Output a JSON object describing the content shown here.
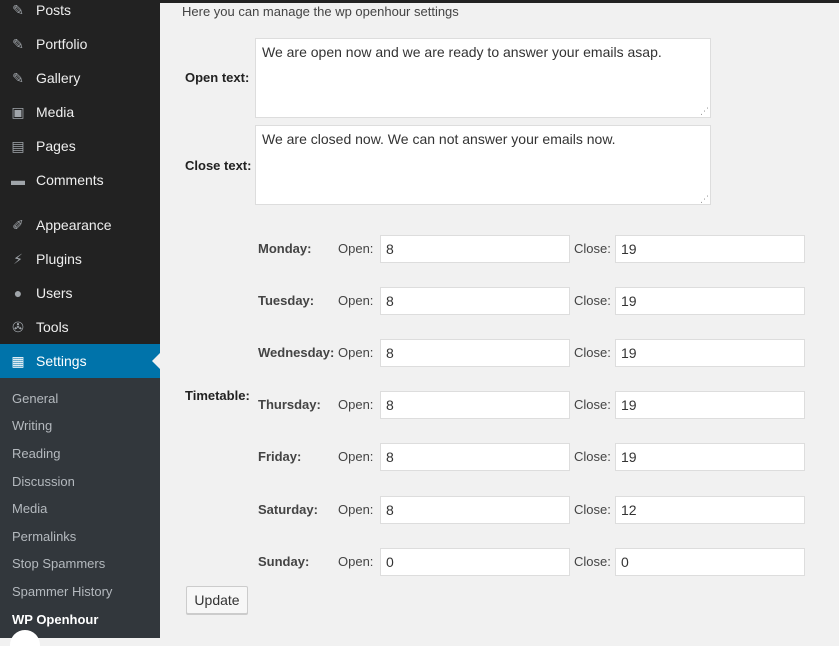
{
  "sidebar": {
    "items": [
      {
        "label": "Posts",
        "icon": "pushpin-icon",
        "glyph": "✎"
      },
      {
        "label": "Portfolio",
        "icon": "pushpin-icon",
        "glyph": "✎"
      },
      {
        "label": "Gallery",
        "icon": "pushpin-icon",
        "glyph": "✎"
      },
      {
        "label": "Media",
        "icon": "media-icon",
        "glyph": "▣"
      },
      {
        "label": "Pages",
        "icon": "pages-icon",
        "glyph": "▤"
      },
      {
        "label": "Comments",
        "icon": "comments-icon",
        "glyph": "▬"
      },
      {
        "label": "Appearance",
        "icon": "appearance-icon",
        "glyph": "✐"
      },
      {
        "label": "Plugins",
        "icon": "plugins-icon",
        "glyph": "⚡"
      },
      {
        "label": "Users",
        "icon": "users-icon",
        "glyph": "●"
      },
      {
        "label": "Tools",
        "icon": "tools-icon",
        "glyph": "✇"
      },
      {
        "label": "Settings",
        "icon": "settings-icon",
        "glyph": "▦"
      }
    ],
    "submenu": [
      "General",
      "Writing",
      "Reading",
      "Discussion",
      "Media",
      "Permalinks",
      "Stop Spammers",
      "Spammer History",
      "WP Openhour"
    ],
    "accent_color": "#0073aa"
  },
  "intro": "Here you can manage the wp openhour settings",
  "open_text": {
    "label": "Open text:",
    "value": "We are open now and we are ready to answer your emails asap."
  },
  "close_text": {
    "label": "Close text:",
    "value": "We are closed now. We can not answer your emails now."
  },
  "timetable": {
    "label": "Timetable:",
    "open_label": "Open:",
    "close_label": "Close:",
    "days": [
      {
        "day": "Monday:",
        "open": "8",
        "close": "19"
      },
      {
        "day": "Tuesday:",
        "open": "8",
        "close": "19"
      },
      {
        "day": "Wednesday:",
        "open": "8",
        "close": "19"
      },
      {
        "day": "Thursday:",
        "open": "8",
        "close": "19"
      },
      {
        "day": "Friday:",
        "open": "8",
        "close": "19"
      },
      {
        "day": "Saturday:",
        "open": "8",
        "close": "12"
      },
      {
        "day": "Sunday:",
        "open": "0",
        "close": "0"
      }
    ]
  },
  "update_label": "Update"
}
